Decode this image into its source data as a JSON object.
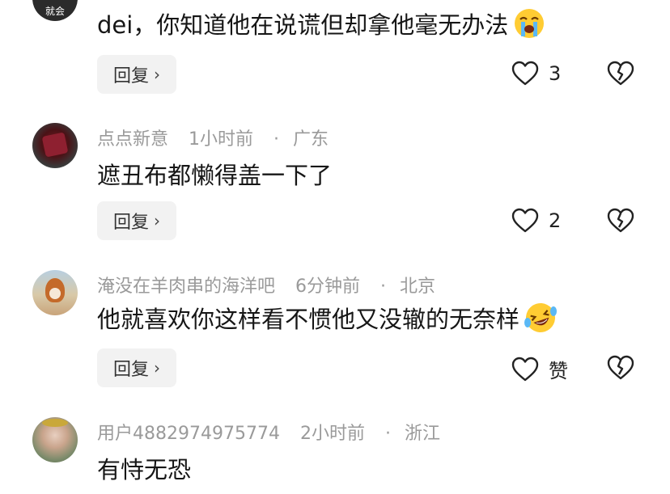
{
  "comments": [
    {
      "avatar_caption": "就会",
      "text": "dei，你知道他在说谎但却拿他毫无办法",
      "emoji": "crying-face-icon",
      "reply_label": "回复",
      "likes": "3"
    },
    {
      "username": "点点新意",
      "time": "1小时前",
      "location": "广东",
      "text": "遮丑布都懒得盖一下了",
      "reply_label": "回复",
      "likes": "2"
    },
    {
      "username": "淹没在羊肉串的海洋吧",
      "time": "6分钟前",
      "location": "北京",
      "text": "他就喜欢你这样看不惯他又没辙的无奈样",
      "emoji": "laughing-tears-face-icon",
      "reply_label": "回复",
      "likes": "赞"
    },
    {
      "username": "用户4882974975774",
      "time": "2小时前",
      "location": "浙江",
      "text": "有恃无恐"
    }
  ],
  "colors": {
    "meta_text": "#9a9a9a",
    "reply_bg": "#f2f2f2",
    "emoji_yellow": "#ffcc33"
  }
}
